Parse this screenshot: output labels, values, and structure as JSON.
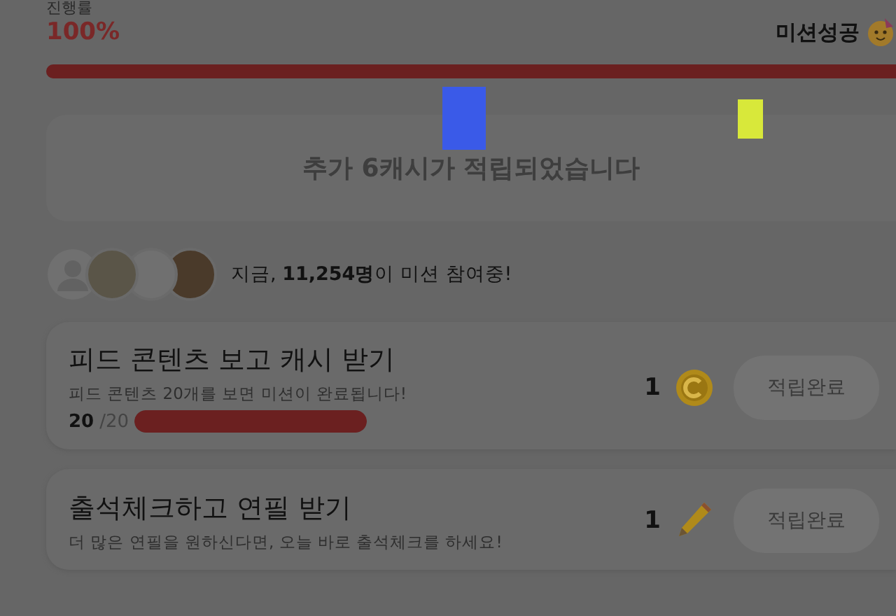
{
  "progress": {
    "label": "진행률",
    "value": "100%",
    "status": "미션성공",
    "level": 1
  },
  "reward_notice": "추가 6캐시가 적립되었습니다",
  "participants": {
    "avatars": [
      {
        "kind": "silhouette"
      },
      {
        "kind": "photo"
      },
      {
        "kind": "photo"
      },
      {
        "kind": "photo"
      }
    ],
    "text": "지금, **11,254명**이 미션 참여중!"
  },
  "missions": [
    {
      "title": "피드 콘텐츠 보고 캐시 받기",
      "description": "피드 콘텐츠 20개를 보면 미션이 완료됩니다!",
      "count": "20",
      "total": "/20",
      "level": 1,
      "reward": "1",
      "kind": "coin",
      "button": "적립완료",
      "disabled": true
    },
    {
      "title": "출석체크하고 연필 받기",
      "description": "더 많은 연필을 원하신다면, 오늘 바로 출석체크를 하세요!",
      "reward": "1",
      "kind": "pencil",
      "button": "적립완료",
      "disabled": true
    }
  ]
}
